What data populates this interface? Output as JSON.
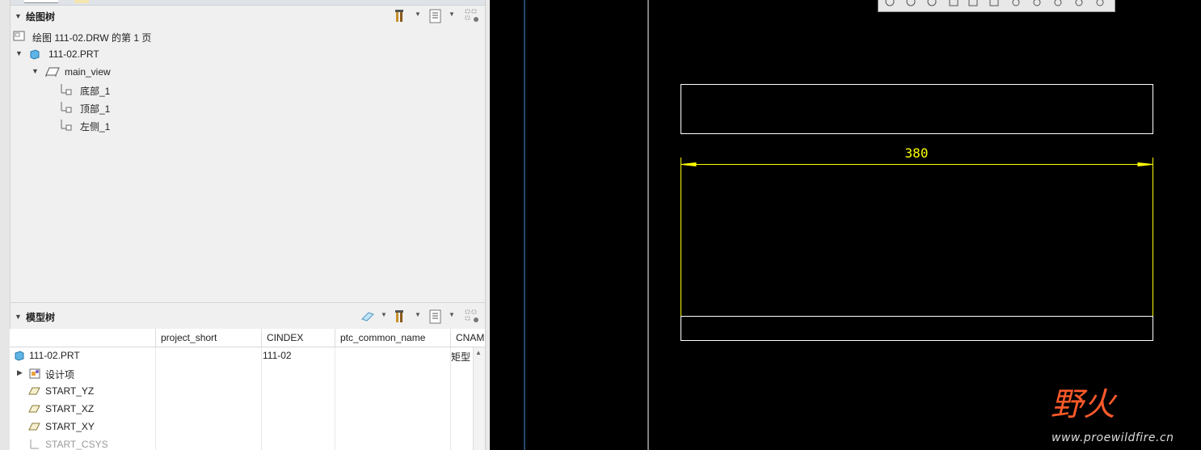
{
  "drawing_tree": {
    "title": "绘图树",
    "items": [
      {
        "label": "绘图 111-02.DRW 的第 1 页"
      },
      {
        "label": "111-02.PRT"
      },
      {
        "label": "main_view"
      },
      {
        "label": "底部_1"
      },
      {
        "label": "顶部_1"
      },
      {
        "label": "左侧_1"
      }
    ]
  },
  "model_tree": {
    "title": "模型树",
    "columns": [
      "project_short",
      "CINDEX",
      "ptc_common_name",
      "CNAM"
    ],
    "rows": [
      {
        "label": "111-02.PRT",
        "cindex": "111-02",
        "cname": "矩型"
      },
      {
        "label": "设计项"
      },
      {
        "label": "START_YZ"
      },
      {
        "label": "START_XZ"
      },
      {
        "label": "START_XY"
      },
      {
        "label": "START_CSYS"
      }
    ]
  },
  "canvas": {
    "dimension_value": "380",
    "dimension_color": "#ffff00",
    "line_color": "#ffffff",
    "watermark_text": "野火",
    "watermark_url": "www.proewildfire.cn"
  }
}
